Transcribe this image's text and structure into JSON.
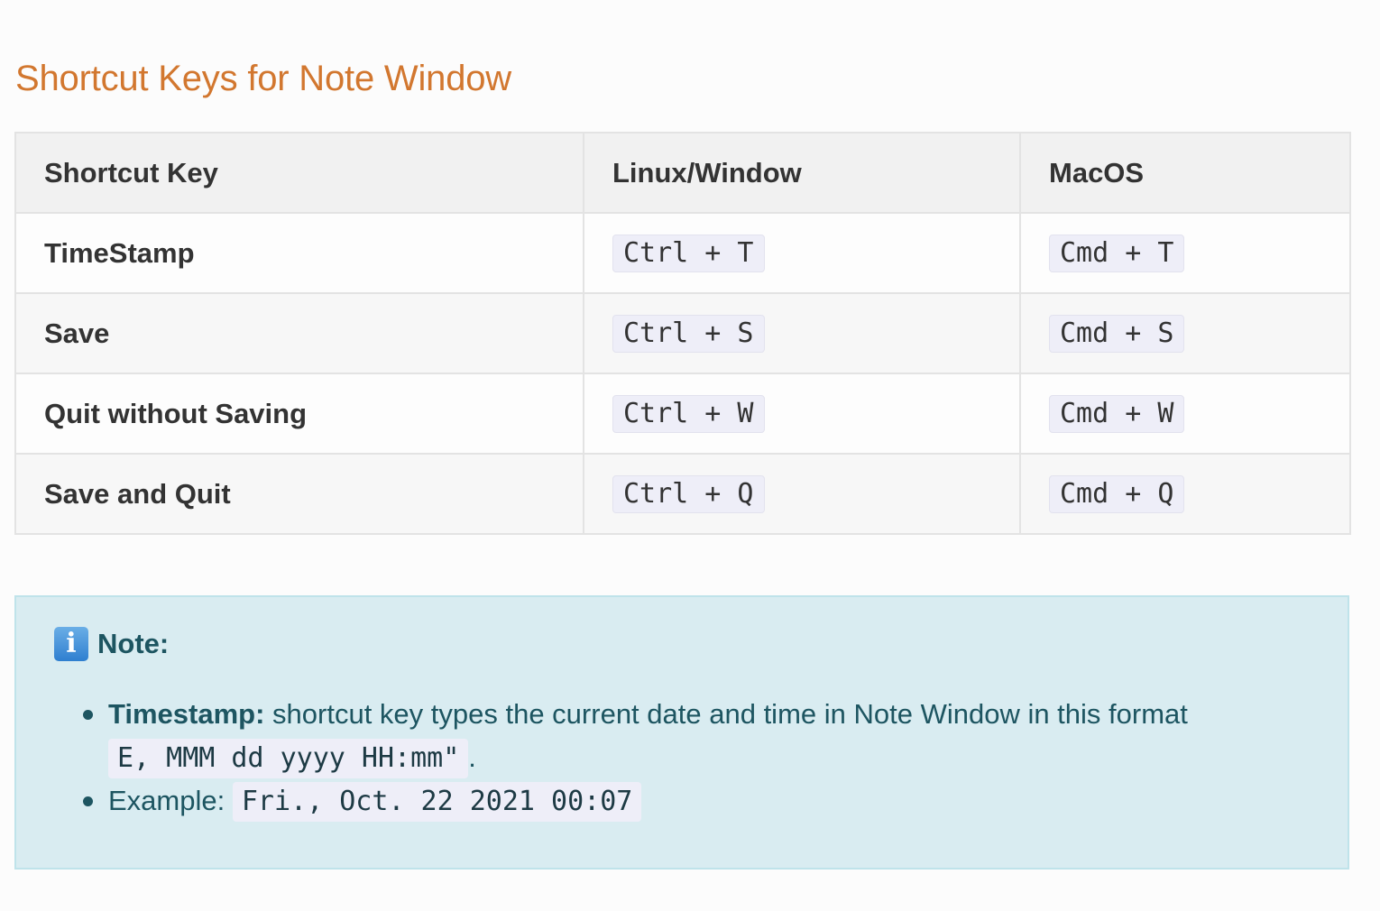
{
  "page": {
    "title": "Shortcut Keys for Note Window"
  },
  "table": {
    "headers": [
      "Shortcut Key",
      "Linux/Window",
      "MacOS"
    ],
    "rows": [
      {
        "action": "TimeStamp",
        "linux": "Ctrl + T",
        "mac": "Cmd + T"
      },
      {
        "action": "Save",
        "linux": "Ctrl + S",
        "mac": "Cmd + S"
      },
      {
        "action": "Quit without Saving",
        "linux": "Ctrl + W",
        "mac": "Cmd + W"
      },
      {
        "action": "Save and Quit",
        "linux": "Ctrl + Q",
        "mac": "Cmd + Q"
      }
    ]
  },
  "note": {
    "icon": "info-icon",
    "icon_glyph": "i",
    "heading": "Note:",
    "item1_label": "Timestamp:",
    "item1_text": " shortcut key types the current date and time in Note Window in this format",
    "item1_code": "E, MMM dd yyyy HH:mm\"",
    "item1_suffix": ".",
    "item2_label": "Example:",
    "item2_code": "Fri., Oct. 22 2021 00:07"
  },
  "colors": {
    "title": "#d2772f",
    "note_background": "#d9ecf1",
    "note_text": "#1d5561"
  }
}
